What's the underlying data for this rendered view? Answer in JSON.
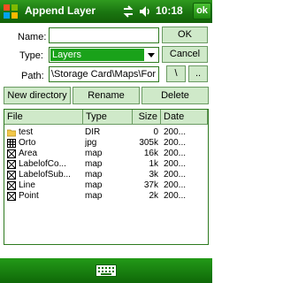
{
  "titlebar": {
    "title": "Append Layer",
    "time": "10:18",
    "ok_label": "ok"
  },
  "form": {
    "name_label": "Name:",
    "name_value": "",
    "type_label": "Type:",
    "type_value": "Layers",
    "path_label": "Path:",
    "path_value": "\\Storage Card\\Maps\\For",
    "ok_label": "OK",
    "cancel_label": "Cancel",
    "backslash_label": "\\",
    "up_label": ".."
  },
  "actions": {
    "new_directory_label": "New directory",
    "rename_label": "Rename",
    "delete_label": "Delete"
  },
  "list": {
    "columns": [
      "File",
      "Type",
      "Size",
      "Date"
    ],
    "rows": [
      {
        "icon": "folder-icon",
        "file": "test",
        "type": "DIR",
        "size": "0",
        "date": "200..."
      },
      {
        "icon": "raster-grid-icon",
        "file": "Orto",
        "type": "jpg",
        "size": "305k",
        "date": "200..."
      },
      {
        "icon": "map-file-icon",
        "file": "Area",
        "type": "map",
        "size": "16k",
        "date": "200..."
      },
      {
        "icon": "map-file-icon",
        "file": "LabelofCo...",
        "type": "map",
        "size": "1k",
        "date": "200..."
      },
      {
        "icon": "map-file-icon",
        "file": "LabelofSub...",
        "type": "map",
        "size": "3k",
        "date": "200..."
      },
      {
        "icon": "map-file-icon",
        "file": "Line",
        "type": "map",
        "size": "37k",
        "date": "200..."
      },
      {
        "icon": "map-file-icon",
        "file": "Point",
        "type": "map",
        "size": "2k",
        "date": "200..."
      }
    ]
  },
  "colors": {
    "accent": "#1aa21a",
    "titlebar": "#1a7410",
    "button_bg": "#cfe9c9"
  }
}
